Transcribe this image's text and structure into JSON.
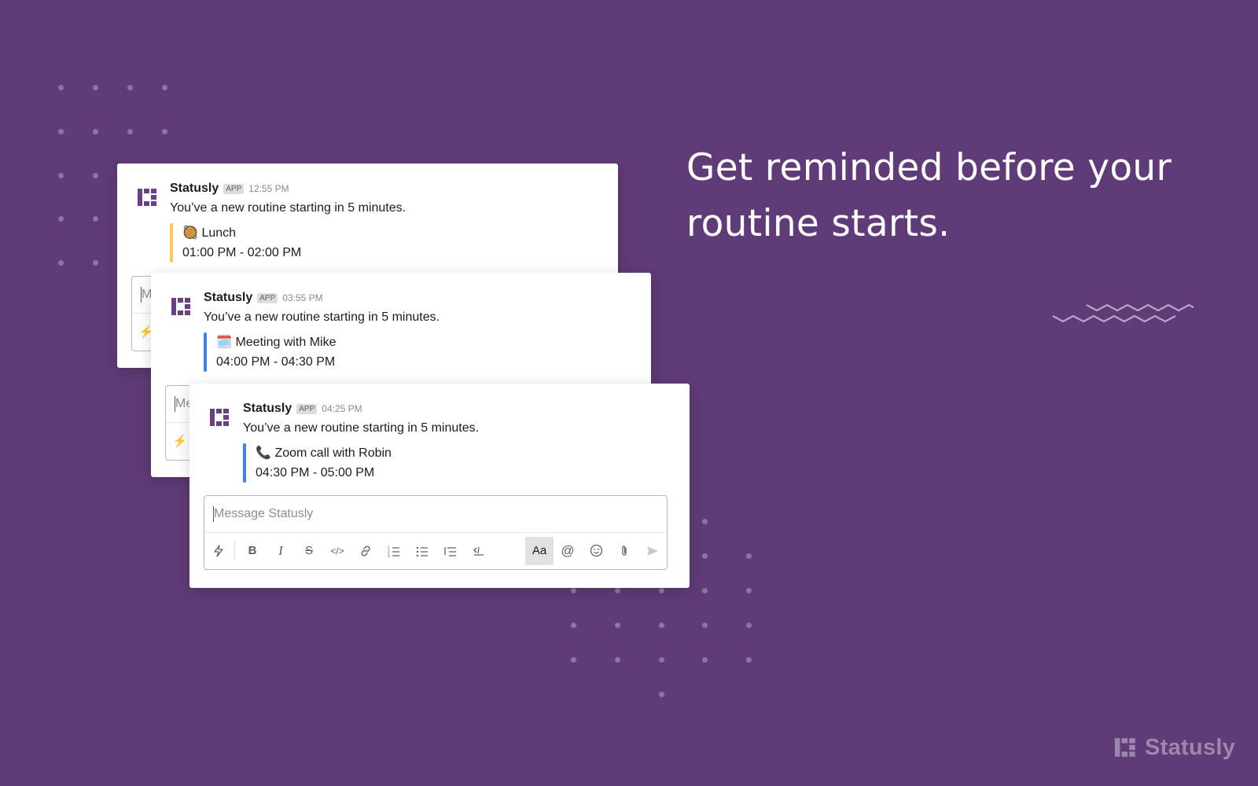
{
  "headline": "Get reminded before your routine starts.",
  "cards": [
    {
      "sender": "Statusly",
      "badge": "APP",
      "time": "12:55 PM",
      "text": "You’ve a new routine starting in 5 minutes.",
      "emoji": "🥘",
      "title": "Lunch",
      "range": "01:00 PM - 02:00 PM",
      "accent": "#f6c85f"
    },
    {
      "sender": "Statusly",
      "badge": "APP",
      "time": "03:55 PM",
      "text": "You’ve a new routine starting in 5 minutes.",
      "emoji": "🗓️",
      "title": "Meeting with Mike",
      "range": "04:00 PM - 04:30 PM",
      "accent": "#3b82f6"
    },
    {
      "sender": "Statusly",
      "badge": "APP",
      "time": "04:25 PM",
      "text": "You’ve a new routine starting in 5 minutes.",
      "emoji": "📞",
      "title": "Zoom call with Robin",
      "range": "04:30 PM - 05:00 PM",
      "accent": "#3b82f6"
    }
  ],
  "composer": {
    "placeholder": "Message Statusly",
    "partial_placeholder": "M",
    "partial_placeholder_2": "Me",
    "format_label": "Aa",
    "toolbar_icons": [
      "shortcut-icon",
      "bold-icon",
      "italic-icon",
      "strikethrough-icon",
      "code-icon",
      "link-icon",
      "ordered-list-icon",
      "bulleted-list-icon",
      "blockquote-icon",
      "code-block-icon",
      "format-toggle",
      "mention-icon",
      "emoji-icon",
      "attach-icon",
      "send-icon"
    ]
  },
  "watermark": {
    "brand": "Statusly"
  },
  "colors": {
    "background": "#5f3b77",
    "brand_purple": "#6b3f85",
    "yellow_accent": "#f6c85f",
    "blue_accent": "#3b82f6"
  }
}
